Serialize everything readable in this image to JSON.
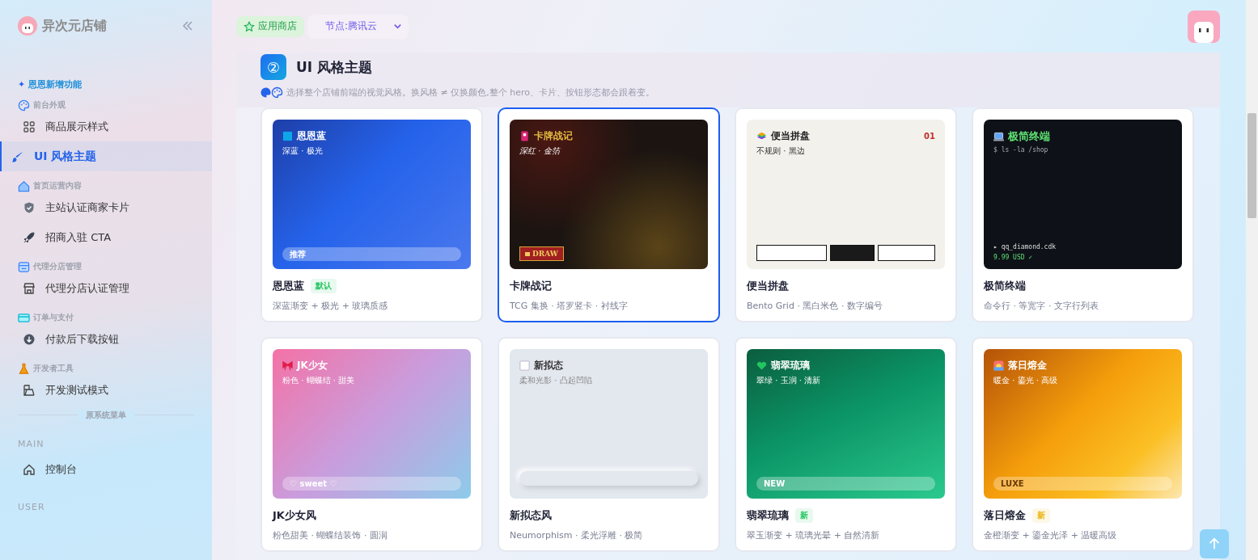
{
  "brand": {
    "name": "异次元店铺"
  },
  "sidebar": {
    "feature_icon": "✦",
    "feature_heading": "恩恩新增功能",
    "groups": [
      {
        "heading": "前台外观",
        "items": [
          {
            "label": "商品展示样式",
            "selected": false
          },
          {
            "label": "UI 风格主题",
            "selected": true
          }
        ]
      },
      {
        "heading": "首页运营内容",
        "items": [
          {
            "label": "主站认证商家卡片",
            "selected": false
          },
          {
            "label": "招商入驻 CTA",
            "selected": false
          }
        ]
      },
      {
        "heading": "代理分店管理",
        "items": [
          {
            "label": "代理分店认证管理",
            "selected": false
          }
        ]
      },
      {
        "heading": "订单与支付",
        "items": [
          {
            "label": "付款后下载按钮",
            "selected": false
          }
        ]
      },
      {
        "heading": "开发者工具",
        "items": [
          {
            "label": "开发测试模式",
            "selected": false
          }
        ]
      }
    ],
    "divider_label": "原系统菜单",
    "system_sections": [
      {
        "heading": "MAIN",
        "items": [
          {
            "label": "控制台",
            "selected": false
          }
        ]
      },
      {
        "heading": "USER"
      }
    ]
  },
  "topbar": {
    "app_store": "应用商店",
    "node_select": {
      "value": "节点:腾讯云"
    }
  },
  "panel": {
    "step": "②",
    "title": "UI 风格主题",
    "description": "选择整个店铺前端的视觉风格。换风格 ≠ 仅换颜色,整个 hero、卡片、按钮形态都会跟着变。"
  },
  "themes": [
    {
      "kind": "aurora",
      "name": "恩恩蓝",
      "badge": {
        "text": "默认",
        "color": "#22c55e"
      },
      "desc": "深蓝渐变 + 极光 + 玻璃质感",
      "selected": false,
      "preview": {
        "title": "恩恩蓝",
        "subtitle": "深蓝 · 极光",
        "tag": "推荐"
      }
    },
    {
      "kind": "tcg",
      "name": "卡牌战记",
      "desc": "TCG 集换 · 塔罗竖卡 · 衬线字",
      "selected": true,
      "preview": {
        "title": "卡牌战记",
        "subtitle": "深红 · 金箔",
        "tag": "DRAW"
      }
    },
    {
      "kind": "bento",
      "name": "便当拼盘",
      "desc": "Bento Grid · 黑白米色 · 数字编号",
      "selected": false,
      "preview": {
        "title": "便当拼盘",
        "subtitle": "不规则 · 黑边",
        "number": "01"
      }
    },
    {
      "kind": "terminal",
      "name": "极简终端",
      "desc": "命令行 · 等宽字 · 文字行列表",
      "selected": false,
      "preview": {
        "title": "极简终端",
        "subtitle": "$ ls -la /shop",
        "lines": [
          "▸ qq_diamond.cdk",
          "9.99 USD ✓"
        ]
      }
    },
    {
      "kind": "jk",
      "name": "JK少女风",
      "desc": "粉色甜美 · 蝴蝶结装饰 · 圆润",
      "selected": false,
      "preview": {
        "title": "JK少女",
        "subtitle": "粉色 · 蝴蝶结 · 甜美",
        "tag": "♡ sweet ♡"
      }
    },
    {
      "kind": "neu",
      "name": "新拟态风",
      "desc": "Neumorphism · 柔光浮雕 · 极简",
      "selected": false,
      "preview": {
        "title": "新拟态",
        "subtitle": "柔和光影 · 凸起凹陷"
      }
    },
    {
      "kind": "jade",
      "name": "翡翠琉璃",
      "badge": {
        "text": "新",
        "color": "#22c55e"
      },
      "desc": "翠玉渐变 + 琉璃光晕 + 自然清新",
      "selected": false,
      "preview": {
        "title": "翡翠琉璃",
        "subtitle": "翠绿 · 玉润 · 清新",
        "tag": "NEW"
      }
    },
    {
      "kind": "gold",
      "name": "落日熔金",
      "badge": {
        "text": "新",
        "color": "#eab308"
      },
      "desc": "金橙渐变 + 鎏金光泽 + 温暖高级",
      "selected": false,
      "preview": {
        "title": "落日熔金",
        "subtitle": "暖金 · 鎏光 · 高级",
        "tag": "LUXE"
      }
    }
  ]
}
